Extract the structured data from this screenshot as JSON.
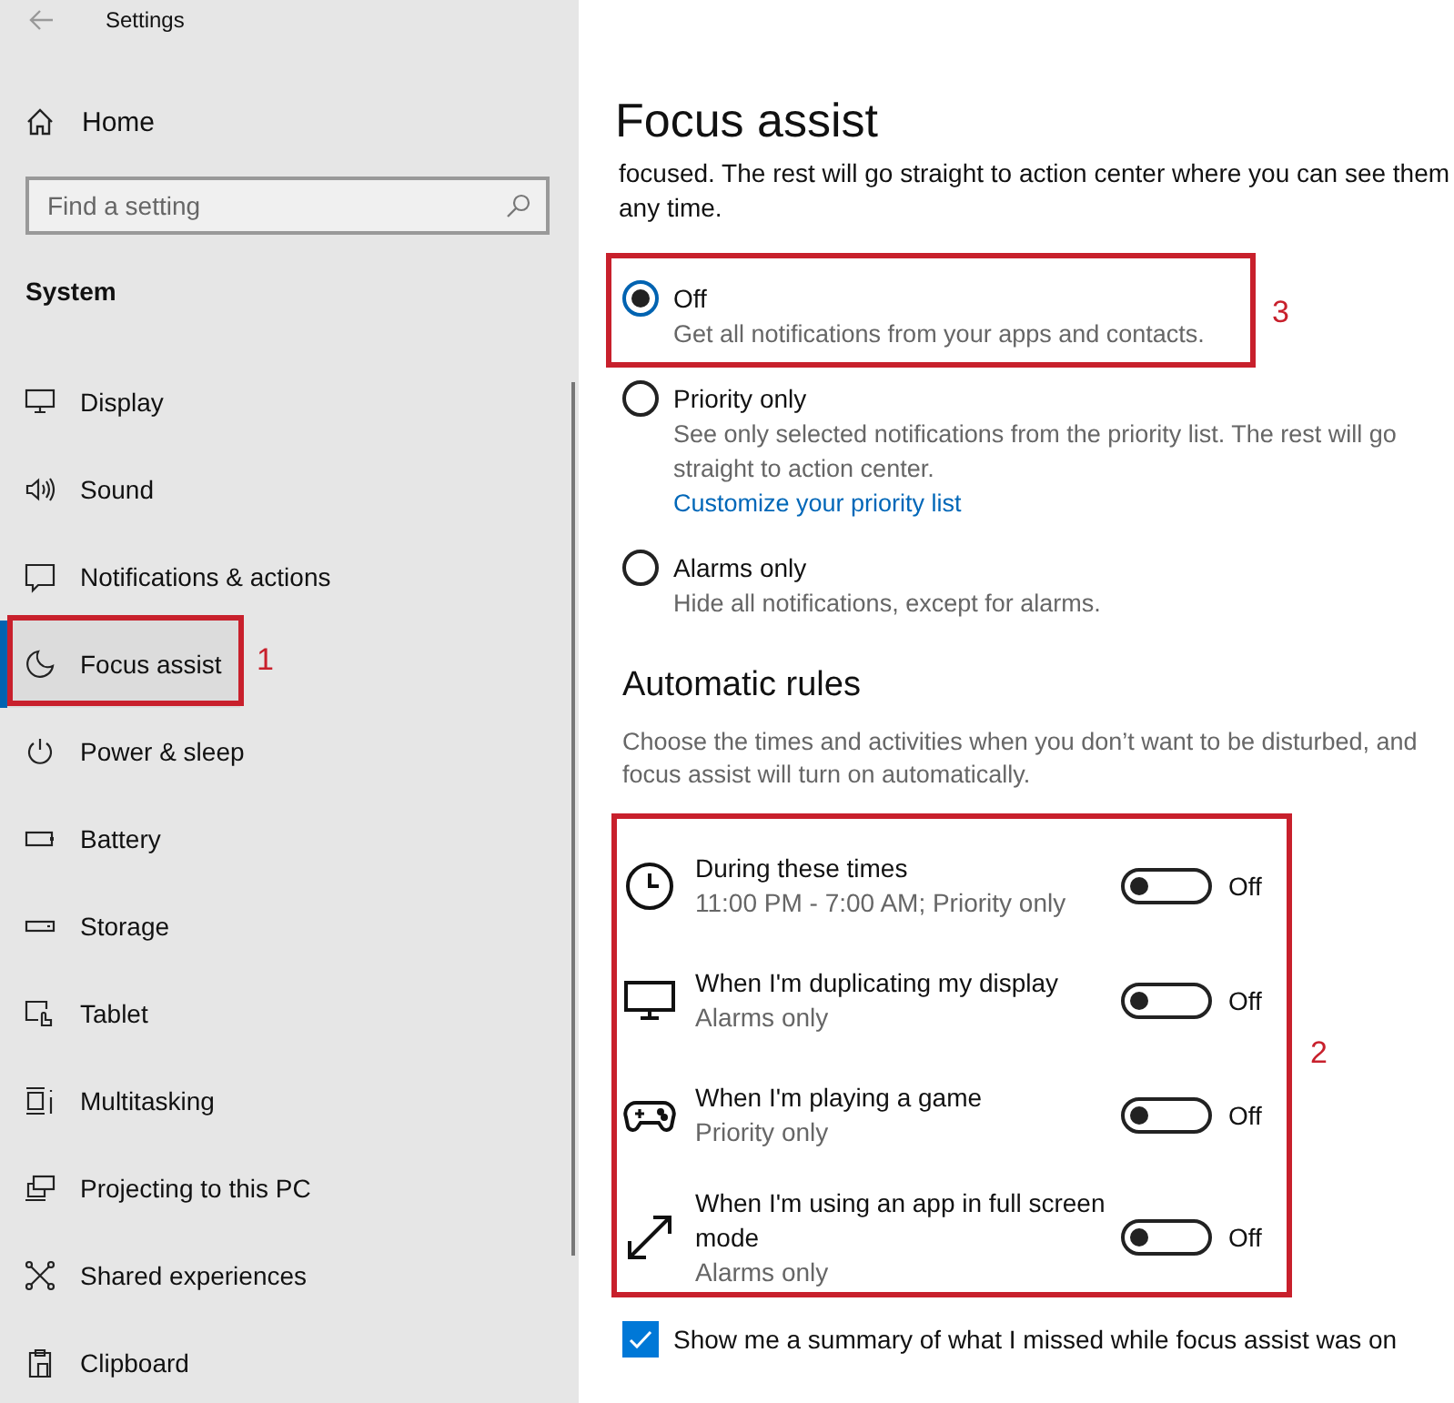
{
  "window": {
    "title": "Settings"
  },
  "sidebar": {
    "home": "Home",
    "search": {
      "placeholder": "Find a setting"
    },
    "section": "System",
    "items": [
      {
        "label": "Display",
        "selected": false
      },
      {
        "label": "Sound",
        "selected": false
      },
      {
        "label": "Notifications & actions",
        "selected": false
      },
      {
        "label": "Focus assist",
        "selected": true
      },
      {
        "label": "Power & sleep",
        "selected": false
      },
      {
        "label": "Battery",
        "selected": false
      },
      {
        "label": "Storage",
        "selected": false
      },
      {
        "label": "Tablet",
        "selected": false
      },
      {
        "label": "Multitasking",
        "selected": false
      },
      {
        "label": "Projecting to this PC",
        "selected": false
      },
      {
        "label": "Shared experiences",
        "selected": false
      },
      {
        "label": "Clipboard",
        "selected": false
      }
    ]
  },
  "page": {
    "title": "Focus assist",
    "intro": "focused. The rest will go straight to action center where you can see them any time.",
    "options": [
      {
        "label": "Off",
        "description": "Get all notifications from your apps and contacts.",
        "selected": true
      },
      {
        "label": "Priority only",
        "description": "See only selected notifications from the priority list. The rest will go straight to action center.",
        "link": "Customize your priority list",
        "selected": false
      },
      {
        "label": "Alarms only",
        "description": "Hide all notifications, except for alarms.",
        "selected": false
      }
    ],
    "rules_heading": "Automatic rules",
    "rules_description": "Choose the times and activities when you don’t want to be disturbed, and focus assist will turn on automatically.",
    "rules": [
      {
        "title": "During these times",
        "subtitle": "11:00 PM - 7:00 AM; Priority only",
        "on": false,
        "state": "Off"
      },
      {
        "title": "When I'm duplicating my display",
        "subtitle": "Alarms only",
        "on": false,
        "state": "Off"
      },
      {
        "title": "When I'm playing a game",
        "subtitle": "Priority only",
        "on": false,
        "state": "Off"
      },
      {
        "title": "When I'm using an app in full screen mode",
        "subtitle": "Alarms only",
        "on": false,
        "state": "Off"
      }
    ],
    "summary": {
      "label": "Show me a summary of what I missed while focus assist was on",
      "checked": true
    }
  },
  "annotations": [
    "1",
    "2",
    "3"
  ]
}
